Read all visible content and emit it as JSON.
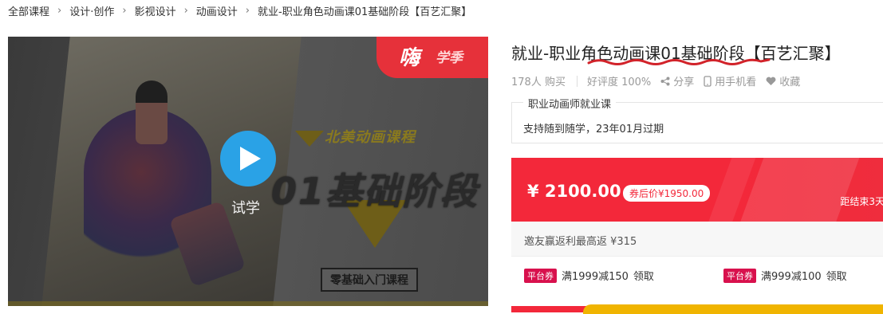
{
  "breadcrumb": [
    {
      "label": "全部课程"
    },
    {
      "label": "设计·创作"
    },
    {
      "label": "影视设计"
    },
    {
      "label": "动画设计"
    },
    {
      "label": "就业-职业角色动画课01基础阶段【百艺汇聚】"
    }
  ],
  "video": {
    "promo_text": "嗨",
    "promo_sub": "学季",
    "sub_title": "北美动画课程",
    "main_title": "01基础阶段",
    "tag": "零基础入门课程",
    "try_label": "试学"
  },
  "course": {
    "title": "就业-职业角色动画课01基础阶段【百艺汇聚】",
    "buyers": "178人 购买",
    "rating": "好评度 100%",
    "share": "分享",
    "mobile": "用手机看",
    "favorite": "收藏"
  },
  "plan": {
    "name": "职业动画师就业课",
    "desc": "支持随到随学，23年01月过期"
  },
  "price": {
    "amount": "¥ 2100.00",
    "after_coupon": "券后价¥1950.00",
    "countdown": "距结束3天"
  },
  "invite": {
    "text": "邀友赢返利最高返 ¥315"
  },
  "coupons": [
    {
      "tag": "平台券",
      "text": "满1999减150",
      "claim": "领取"
    },
    {
      "tag": "平台券",
      "text": "满999减100",
      "claim": "领取"
    }
  ],
  "colors": {
    "accent": "#f3283a",
    "play": "#2aa2e6",
    "coupon_tag": "#d8114d"
  }
}
